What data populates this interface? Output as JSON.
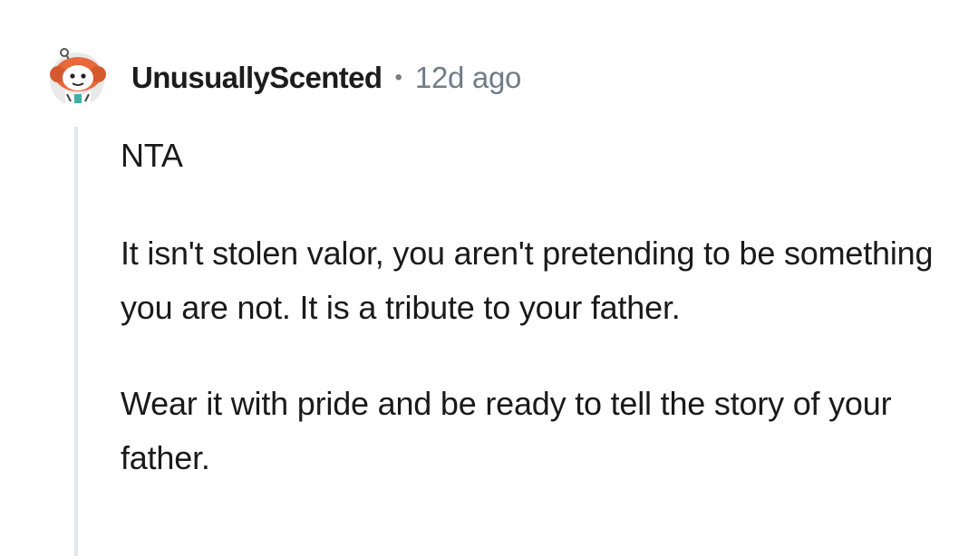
{
  "comment": {
    "author": "UnusuallyScented",
    "separator": "•",
    "timestamp": "12d ago",
    "paragraphs": [
      "NTA",
      "It isn't stolen valor, you aren't pretending to be something you are not. It is a tribute to your father.",
      "Wear it with pride and be ready to tell the story of your father."
    ]
  },
  "avatar": {
    "icon": "reddit-snoo-avatar-icon",
    "colors": {
      "hair": "#e8693a",
      "face": "#ffffff",
      "background": "#e9e9e9"
    }
  },
  "theme": {
    "text": "#1a1a1b",
    "meta": "#6e7d87",
    "thread_line": "#e5e6e7"
  }
}
